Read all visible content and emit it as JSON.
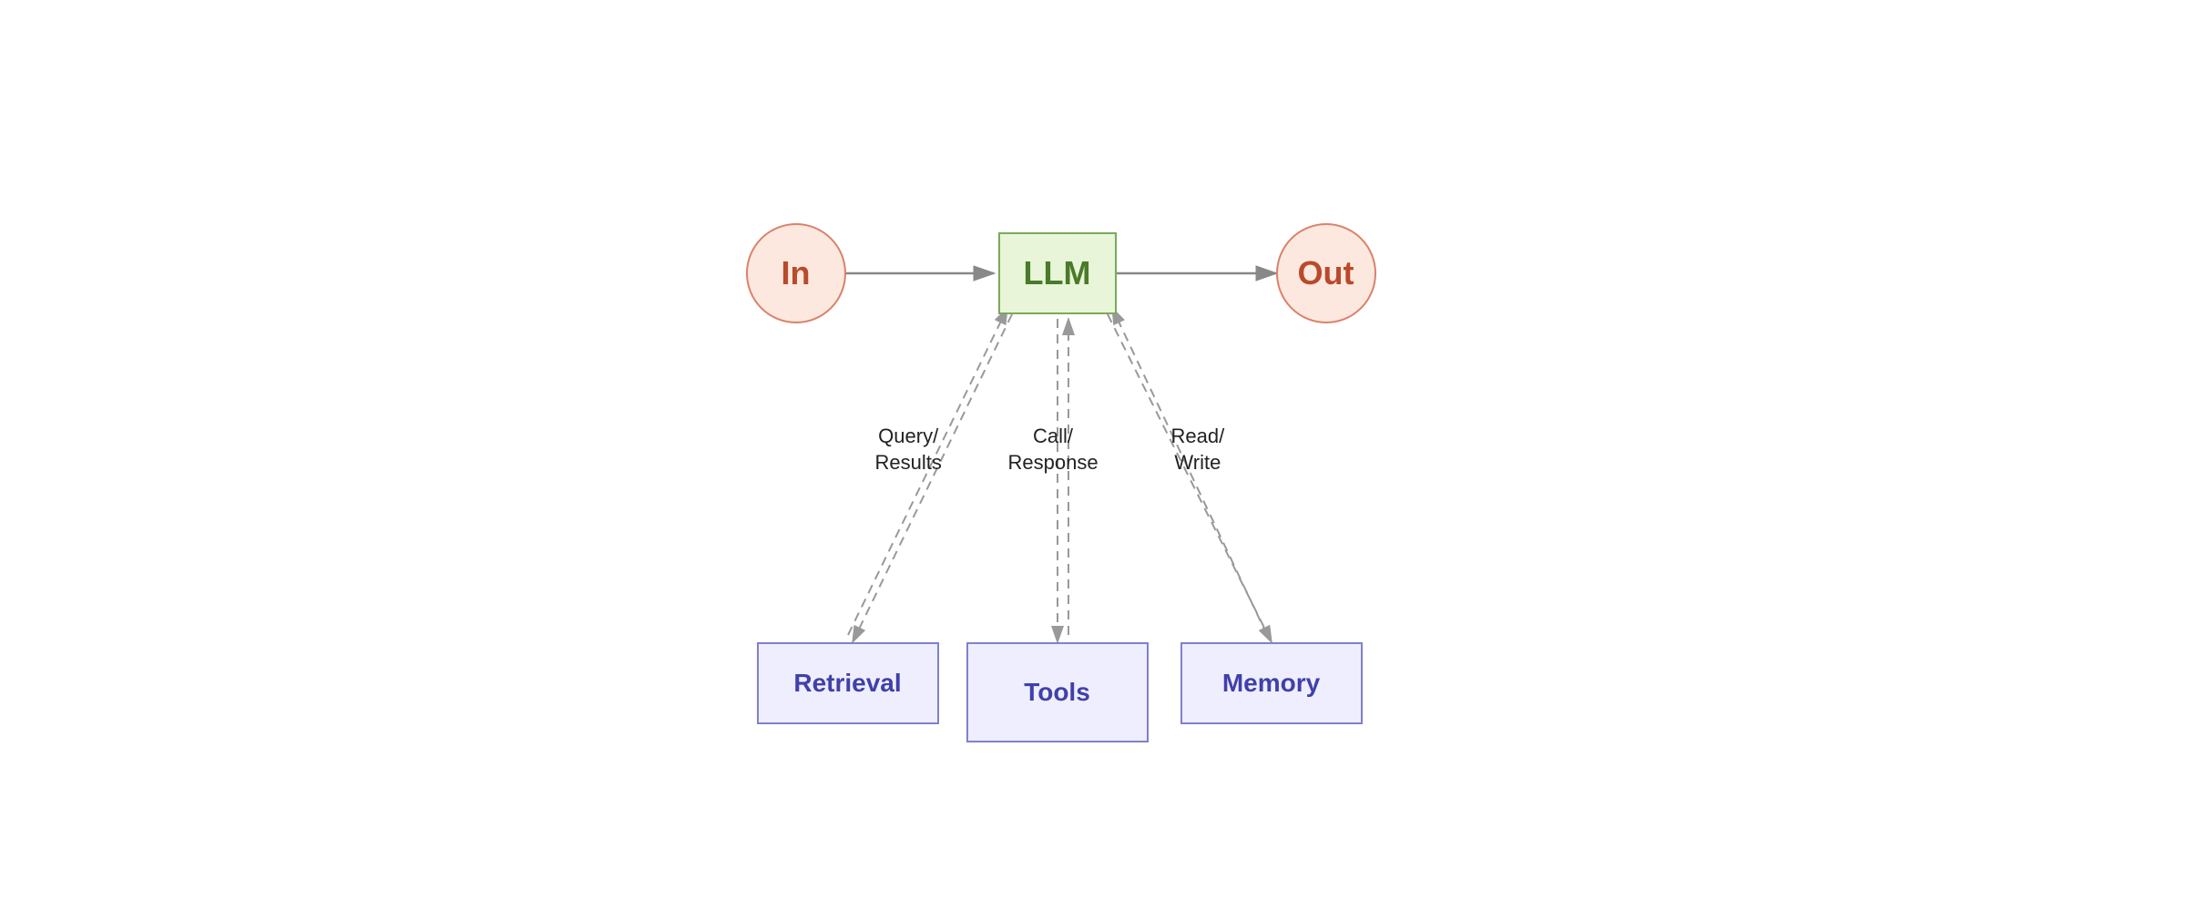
{
  "nodes": {
    "in_label": "In",
    "llm_label": "LLM",
    "out_label": "Out",
    "retrieval_label": "Retrieval",
    "tools_label": "Tools",
    "memory_label": "Memory"
  },
  "labels": {
    "query_results": "Query/\nResults",
    "call_response": "Call/\nResponse",
    "read_write": "Read/\nWrite"
  },
  "colors": {
    "in_out_border": "#d9826a",
    "in_out_bg": "#fde8e0",
    "in_out_text": "#b94a2a",
    "llm_border": "#7aaa5a",
    "llm_bg": "#e8f5d8",
    "llm_text": "#4a7a2a",
    "box_border": "#8080cc",
    "box_bg": "#eeeeff",
    "box_text": "#4040aa",
    "arrow_solid": "#888888",
    "arrow_dashed": "#999999"
  }
}
